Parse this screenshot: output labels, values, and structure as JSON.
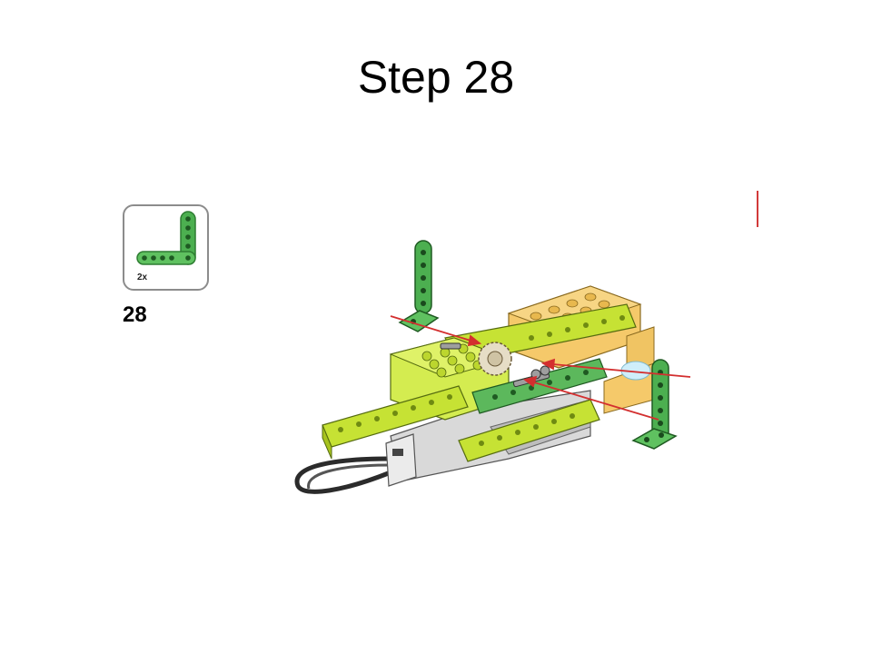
{
  "slide": {
    "title": "Step 28",
    "step_number": "28",
    "parts": {
      "quantity": "2x",
      "piece_icon": "green-l-beam-icon"
    }
  },
  "colors": {
    "lime": "#c6e234",
    "lime_dark": "#9cbc1e",
    "green": "#4caf50",
    "green_dark": "#2e7d32",
    "tan": "#f0c463",
    "tan_dark": "#d9a43c",
    "grey": "#c8c8c8",
    "arrow_red": "#d32f2f"
  }
}
